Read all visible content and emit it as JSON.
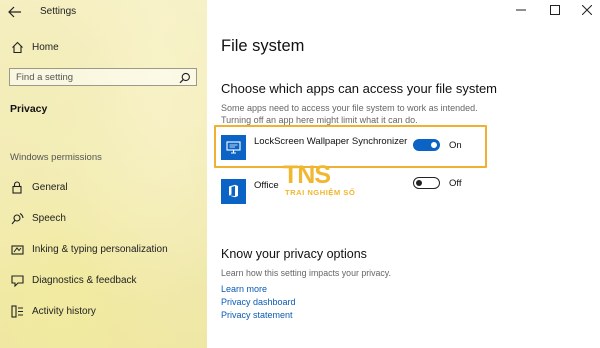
{
  "window": {
    "app_title": "Settings"
  },
  "sidebar": {
    "home_label": "Home",
    "search_placeholder": "Find a setting",
    "section_title": "Privacy",
    "group_header": "Windows permissions",
    "items": [
      {
        "label": "General",
        "icon": "lock-icon"
      },
      {
        "label": "Speech",
        "icon": "speech-icon"
      },
      {
        "label": "Inking & typing personalization",
        "icon": "inking-icon"
      },
      {
        "label": "Diagnostics & feedback",
        "icon": "diagnostics-icon"
      },
      {
        "label": "Activity history",
        "icon": "activity-icon"
      }
    ]
  },
  "main": {
    "page_title": "File system",
    "section_heading": "Choose which apps can access your file system",
    "section_description": "Some apps need to access your file system to work as intended. Turning off an app here might limit what it can do.",
    "apps": [
      {
        "name": "LockScreen Wallpaper Synchronizer",
        "state_label": "On",
        "enabled": true,
        "tile_color": "#0b63c5"
      },
      {
        "name": "Office",
        "state_label": "Off",
        "enabled": false,
        "tile_color": "#0b63c5"
      }
    ],
    "privacy_heading": "Know your privacy options",
    "privacy_description": "Learn how this setting impacts your privacy.",
    "links": [
      "Learn more",
      "Privacy dashboard",
      "Privacy statement"
    ]
  },
  "watermark": {
    "logo_text": "TNS",
    "subtitle": "TRAI NGHIỆM SỐ"
  },
  "colors": {
    "accent": "#0b63c5",
    "highlight": "#f0b132",
    "link": "#0a5bb5"
  }
}
